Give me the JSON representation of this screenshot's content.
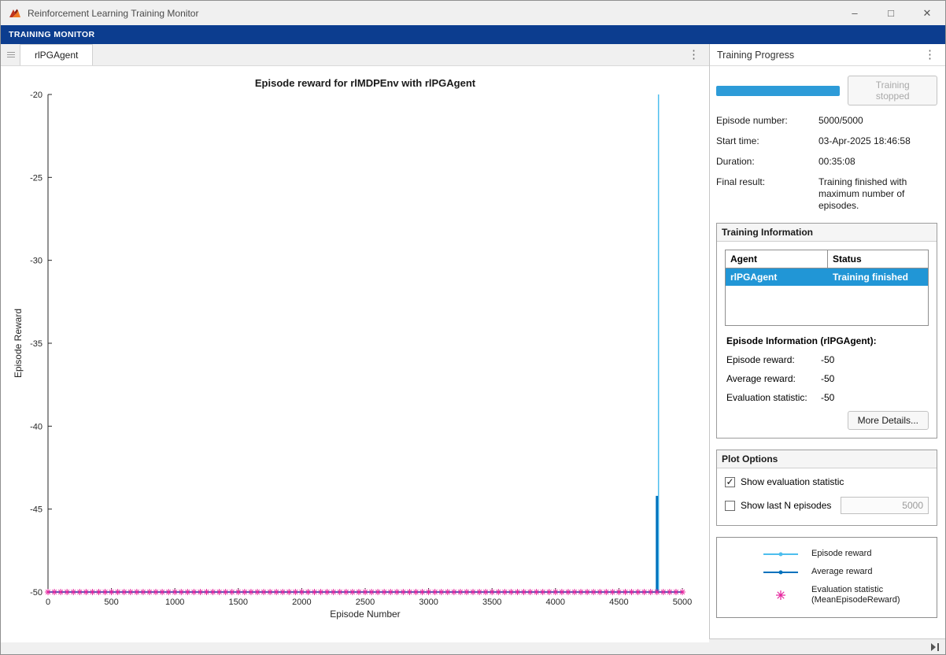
{
  "icons": {
    "minimize": "–",
    "maximize": "□",
    "close": "✕",
    "kebab": "⋮",
    "check": "✓"
  },
  "window": {
    "title": "Reinforcement Learning Training Monitor",
    "ribbon_tab": "TRAINING MONITOR"
  },
  "document": {
    "tab_label": "rlPGAgent"
  },
  "panel": {
    "title": "Training Progress",
    "progress": {
      "percent": 100,
      "status_button": "Training stopped"
    },
    "fields": [
      {
        "label": "Episode number:",
        "value": "5000/5000"
      },
      {
        "label": "Start time:",
        "value": "03-Apr-2025 18:46:58"
      },
      {
        "label": "Duration:",
        "value": "00:35:08"
      },
      {
        "label": "Final result:",
        "value": "Training finished with maximum number of episodes."
      }
    ],
    "training_information": {
      "title": "Training Information",
      "table": {
        "headers": [
          "Agent",
          "Status"
        ],
        "rows": [
          {
            "agent": "rlPGAgent",
            "status": "Training finished",
            "selected": true
          }
        ]
      },
      "episode_info_title": "Episode Information (rlPGAgent):",
      "stats": [
        {
          "label": "Episode reward:",
          "value": "-50"
        },
        {
          "label": "Average reward:",
          "value": "-50"
        },
        {
          "label": "Evaluation statistic:",
          "value": "-50"
        }
      ],
      "more_details_button": "More Details..."
    },
    "plot_options": {
      "title": "Plot Options",
      "show_eval": {
        "label": "Show evaluation statistic",
        "checked": true
      },
      "show_last_n": {
        "label": "Show last N episodes",
        "checked": false,
        "value": "5000"
      }
    },
    "legend": {
      "items": [
        {
          "label": "Episode reward",
          "marker": "line-dot",
          "color": "#4DBEEE"
        },
        {
          "label": "Average reward",
          "marker": "line-dot",
          "color": "#0072BD"
        },
        {
          "label": "Evaluation statistic (MeanEpisodeReward)",
          "marker": "asterisk",
          "color": "#E5239D"
        }
      ]
    }
  },
  "chart_data": {
    "type": "line",
    "title": "Episode reward for rlMDPEnv with rlPGAgent",
    "xlabel": "Episode Number",
    "ylabel": "Episode Reward",
    "xlim": [
      0,
      5000
    ],
    "ylim": [
      -50,
      -20
    ],
    "xticks": [
      0,
      500,
      1000,
      1500,
      2000,
      2500,
      3000,
      3500,
      4000,
      4500,
      5000
    ],
    "yticks": [
      -50,
      -45,
      -40,
      -35,
      -30,
      -25,
      -20
    ],
    "grid": false,
    "series": [
      {
        "name": "Episode reward",
        "type": "line",
        "color": "#4DBEEE",
        "baseline_y": -50,
        "baseline_width": 1.2,
        "width": 1.5,
        "spikes": [
          {
            "x": 4812,
            "y": -20
          }
        ],
        "description": "Reward is -50 for nearly every episode, with a single spike to -20 near episode 4812"
      },
      {
        "name": "Average reward",
        "type": "line",
        "color": "#0072BD",
        "baseline_y": -50,
        "baseline_width": 2,
        "width": 3,
        "spikes": [
          {
            "x": 4800,
            "y": -44.2
          }
        ],
        "description": "Average reward stays at -50 with a brief rise to about -44.2 near episode 4800"
      },
      {
        "name": "Evaluation statistic (MeanEpisodeReward)",
        "type": "scatter",
        "marker": "asterisk",
        "color": "#E5239D",
        "y_value": -50,
        "x_start": 0,
        "x_end": 5000,
        "x_step": 50,
        "description": "Evaluation statistic of -50 plotted every 50 episodes from 0 to 5000"
      }
    ]
  }
}
